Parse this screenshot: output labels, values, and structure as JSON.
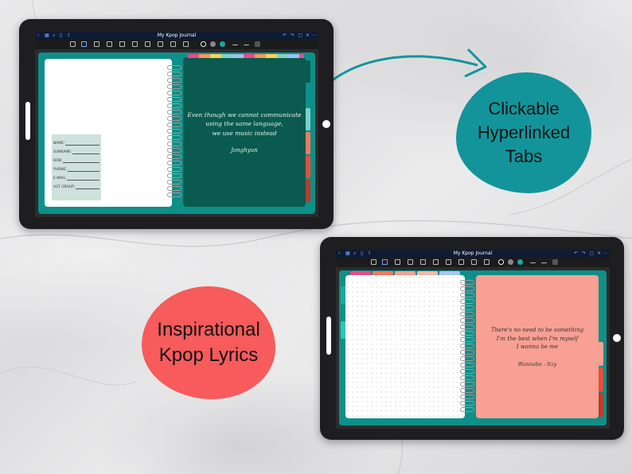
{
  "app": {
    "title": "My Kpop Journal"
  },
  "top_tablet": {
    "form_fields": [
      "NAME:",
      "SURNAME:",
      "DOB:",
      "PHONE:",
      "E-MAIL:",
      "UST GROUP:"
    ],
    "lyric_lines": [
      "Even though we cannot communicate",
      "using the same language,",
      "we use music instead"
    ],
    "signature": "Jonghyun",
    "page_color": "#0a5a4f",
    "tab_colors": [
      "#0a5a4f",
      "#0e8f88",
      "#7ecfc9",
      "#f27a62",
      "#e24f3c",
      "#c94a3a",
      "#b73d2c"
    ]
  },
  "bottom_tablet": {
    "lyric_lines": [
      "There's no need to be something",
      "I'm the best when I'm myself",
      "I wanna be me"
    ],
    "signature": "Wannabe - Itzy",
    "page_color": "#f8a093",
    "top_tab_colors": [
      "#e24f83",
      "#f27a62",
      "#f8a093",
      "#f5b8a7",
      "#a8c8f0"
    ]
  },
  "callouts": {
    "teal_text": "Clickable Hyperlinked Tabs",
    "teal_lines": [
      "Clickable",
      "Hyperlinked",
      "Tabs"
    ],
    "teal_color": "#13949b",
    "red_text": "Inspirational Kpop Lyrics",
    "red_lines": [
      "Inspirational",
      "Kpop Lyrics"
    ],
    "red_color": "#f75b5b"
  }
}
